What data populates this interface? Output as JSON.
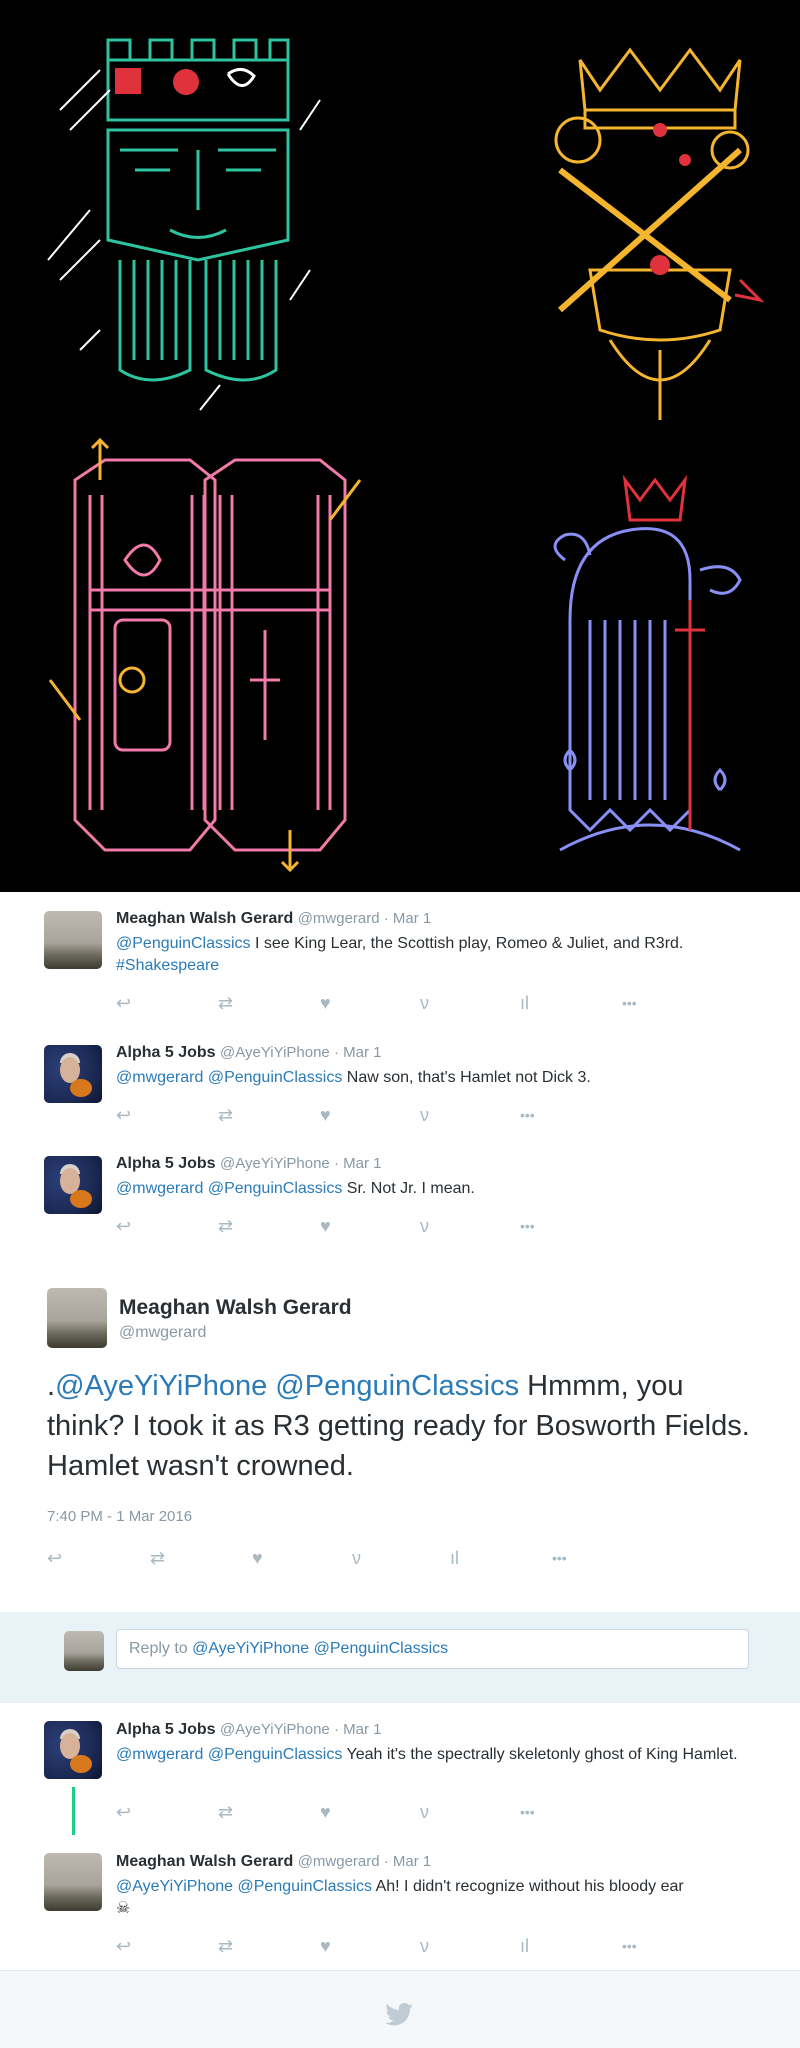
{
  "tweets": [
    {
      "name": "Meaghan Walsh Gerard",
      "meta": "@mwgerard · Mar 1",
      "text_mentions": "@PenguinClassics",
      "text_body": " I see King Lear, the Scottish play, Romeo & Juliet, and R3rd.",
      "hashtag": "#Shakespeare"
    },
    {
      "name": "Alpha 5 Jobs",
      "meta": "@AyeYiYiPhone · Mar 1",
      "text_mentions": "@mwgerard @PenguinClassics",
      "text_body": " Naw son, that's Hamlet not Dick 3."
    },
    {
      "name": "Alpha 5 Jobs",
      "meta": "@AyeYiYiPhone · Mar 1",
      "text_mentions": "@mwgerard @PenguinClassics",
      "text_body": " Sr. Not Jr. I mean."
    }
  ],
  "main_tweet": {
    "name": "Meaghan Walsh Gerard",
    "handle": "@mwgerard",
    "text_prefix": ".",
    "text_mentions": "@AyeYiYiPhone @PenguinClassics",
    "text_body": " Hmmm, you think? I took it as R3 getting ready for Bosworth Fields. Hamlet wasn't crowned.",
    "timestamp": "7:40 PM - 1 Mar 2016"
  },
  "reply": {
    "prefix": "Reply to ",
    "mentions": "@AyeYiYiPhone @PenguinClassics"
  },
  "replies": [
    {
      "name": "Alpha 5 Jobs",
      "meta": "@AyeYiYiPhone · Mar 1",
      "text_mentions": "@mwgerard @PenguinClassics",
      "text_body": " Yeah it's the spectrally skeletonly ghost of King Hamlet."
    },
    {
      "name": "Meaghan Walsh Gerard",
      "meta": "@mwgerard · Mar 1",
      "text_mentions": "@AyeYiYiPhone @PenguinClassics",
      "text_body": " Ah! I didn't recognize without his bloody ear",
      "emoji": "☠"
    }
  ],
  "icons": {
    "reply": "↩",
    "retweet": "⇄",
    "like": "♥",
    "vine": "ν",
    "analytics": "ıl",
    "more": "•••"
  },
  "colors": {
    "link": "#2b7bb9",
    "icon_gray": "#aab8c2",
    "art_teal": "#2ec4a0",
    "art_gold": "#f5b52e",
    "art_pink": "#f07aa8",
    "art_blue": "#8a8ff5",
    "art_red": "#e0323c"
  }
}
